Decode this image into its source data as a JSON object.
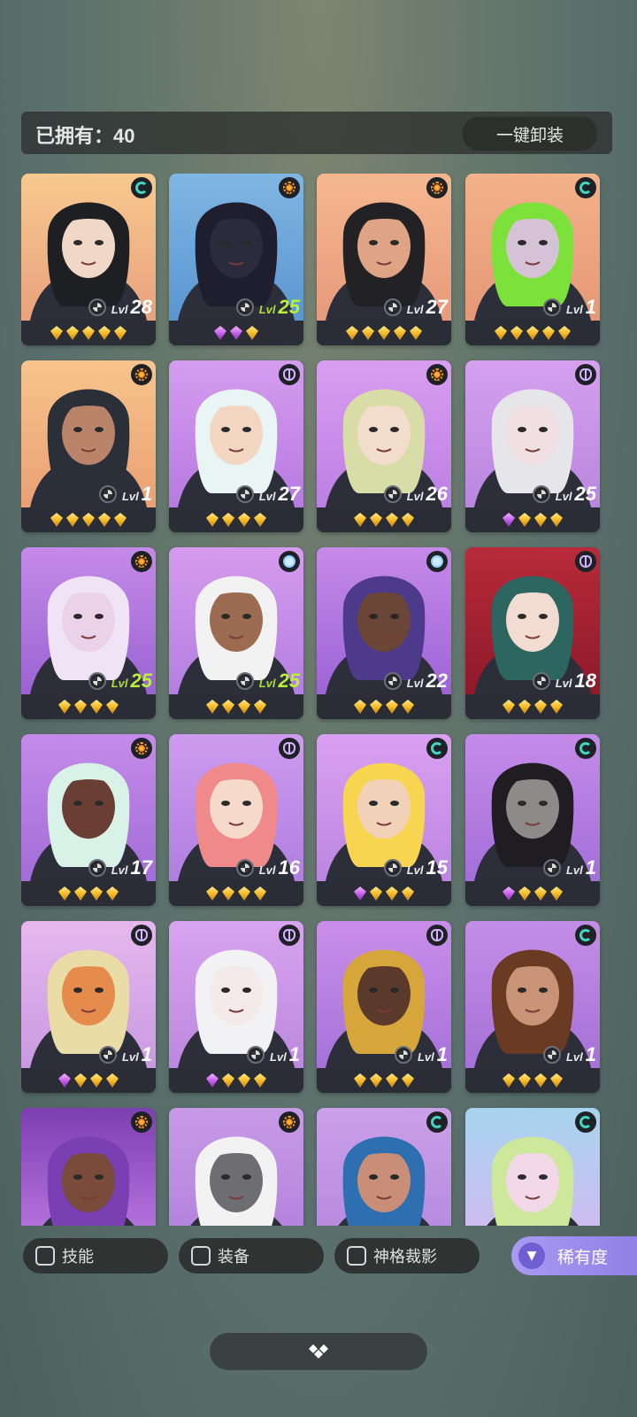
{
  "header": {
    "owned_label": "已拥有：",
    "owned_count": "40",
    "unequip_label": "一键卸装"
  },
  "lvl_prefix": "Lvl",
  "cards": [
    {
      "level": "28",
      "faction": "wind",
      "stars": [
        "gold",
        "gold",
        "gold",
        "gold",
        "gold"
      ],
      "bg": [
        "#f7c98f",
        "#e9a17d"
      ],
      "hair": "#1d1f22",
      "skin": "#f0d7c6",
      "hi": false
    },
    {
      "level": "25",
      "faction": "sun",
      "stars": [
        "purple",
        "purple",
        "gold"
      ],
      "bg": [
        "#7fb6e4",
        "#5a95cf"
      ],
      "hair": "#1e1e2e",
      "skin": "#2b2b3b",
      "hi": true
    },
    {
      "level": "27",
      "faction": "sun",
      "stars": [
        "gold",
        "gold",
        "gold",
        "gold",
        "gold"
      ],
      "bg": [
        "#f5b78f",
        "#e79a7d"
      ],
      "hair": "#222124",
      "skin": "#dfa486",
      "hi": false
    },
    {
      "level": "1",
      "faction": "wind",
      "stars": [
        "gold",
        "gold",
        "gold",
        "gold",
        "gold"
      ],
      "bg": [
        "#f2b28a",
        "#e69776"
      ],
      "hair": "#7de13b",
      "skin": "#d6c2d6",
      "hi": false
    },
    {
      "level": "1",
      "faction": "sun",
      "stars": [
        "gold",
        "gold",
        "gold",
        "gold",
        "gold"
      ],
      "bg": [
        "#f8c48d",
        "#e9a074"
      ],
      "hair": "#2b2f38",
      "skin": "#b9846a",
      "hi": false
    },
    {
      "level": "27",
      "faction": "moon",
      "stars": [
        "gold",
        "gold",
        "gold",
        "gold"
      ],
      "bg": [
        "#d49cf0",
        "#b77ae0"
      ],
      "hair": "#e9f5f5",
      "skin": "#f3d6c2",
      "hi": false
    },
    {
      "level": "26",
      "faction": "sun",
      "stars": [
        "gold",
        "gold",
        "gold",
        "gold"
      ],
      "bg": [
        "#d99df1",
        "#bb80e2"
      ],
      "hair": "#d8dca6",
      "skin": "#f2dccb",
      "hi": false
    },
    {
      "level": "25",
      "faction": "moon",
      "stars": [
        "purple",
        "gold",
        "gold",
        "gold"
      ],
      "bg": [
        "#d6a0ef",
        "#b986df"
      ],
      "hair": "#e6e6ea",
      "skin": "#f0e0e4",
      "hi": false
    },
    {
      "level": "25",
      "faction": "sun",
      "stars": [
        "gold",
        "gold",
        "gold",
        "gold"
      ],
      "bg": [
        "#c58ae8",
        "#9a63d2"
      ],
      "hair": "#efe3f5",
      "skin": "#ead2e8",
      "hi": true
    },
    {
      "level": "25",
      "faction": "cross",
      "stars": [
        "gold",
        "gold",
        "gold",
        "gold"
      ],
      "bg": [
        "#d59bee",
        "#b37fe0"
      ],
      "hair": "#f2f2f2",
      "skin": "#9c6b52",
      "hi": true
    },
    {
      "level": "22",
      "faction": "cross",
      "stars": [
        "gold",
        "gold",
        "gold",
        "gold"
      ],
      "bg": [
        "#c68ae9",
        "#9d64d6"
      ],
      "hair": "#4d3a8a",
      "skin": "#6b4536",
      "hi": false
    },
    {
      "level": "18",
      "faction": "moon",
      "stars": [
        "gold",
        "gold",
        "gold",
        "gold"
      ],
      "bg": [
        "#b82a3a",
        "#8e1a2a"
      ],
      "hair": "#2d6660",
      "skin": "#f2dcd2",
      "hi": false
    },
    {
      "level": "17",
      "faction": "sun",
      "stars": [
        "gold",
        "gold",
        "gold",
        "gold"
      ],
      "bg": [
        "#c58be9",
        "#a26dd8"
      ],
      "hair": "#d8f2e8",
      "skin": "#6a3e33",
      "hi": false
    },
    {
      "level": "16",
      "faction": "moon",
      "stars": [
        "gold",
        "gold",
        "gold",
        "gold"
      ],
      "bg": [
        "#ce9bef",
        "#b07fdf"
      ],
      "hair": "#f08a8a",
      "skin": "#f5dacc",
      "hi": false
    },
    {
      "level": "15",
      "faction": "wind",
      "stars": [
        "purple",
        "gold",
        "gold",
        "gold"
      ],
      "bg": [
        "#d9a0f1",
        "#bc85e1"
      ],
      "hair": "#f7d550",
      "skin": "#f1d2b8",
      "hi": false
    },
    {
      "level": "1",
      "faction": "wind",
      "stars": [
        "purple",
        "gold",
        "gold",
        "gold"
      ],
      "bg": [
        "#c58be9",
        "#a36fd9"
      ],
      "hair": "#1f1d22",
      "skin": "#8d8a8a",
      "hi": false
    },
    {
      "level": "1",
      "faction": "moon",
      "stars": [
        "purple",
        "gold",
        "gold",
        "gold"
      ],
      "bg": [
        "#e6b7ee",
        "#c99ae0"
      ],
      "hair": "#e9dca6",
      "skin": "#e58b4c",
      "hi": false
    },
    {
      "level": "1",
      "faction": "moon",
      "stars": [
        "purple",
        "gold",
        "gold",
        "gold"
      ],
      "bg": [
        "#d8a4ef",
        "#bc88df"
      ],
      "hair": "#f2f2f5",
      "skin": "#f5eaea",
      "hi": false
    },
    {
      "level": "1",
      "faction": "moon",
      "stars": [
        "gold",
        "gold",
        "gold",
        "gold"
      ],
      "bg": [
        "#c98ee9",
        "#a672da"
      ],
      "hair": "#d7a63a",
      "skin": "#5b3a2c",
      "hi": false
    },
    {
      "level": "1",
      "faction": "wind",
      "stars": [
        "gold",
        "gold",
        "gold",
        "gold"
      ],
      "bg": [
        "#c48de6",
        "#a671d8"
      ],
      "hair": "#6b3a22",
      "skin": "#c99377",
      "hi": false
    },
    {
      "level": "",
      "faction": "sun",
      "stars": [],
      "bg": [
        "#7c3fb0",
        "#c07de6"
      ],
      "hair": "#7a3fb2",
      "skin": "#7a4a3a",
      "hi": false
    },
    {
      "level": "",
      "faction": "sun",
      "stars": [],
      "bg": [
        "#c79ae6",
        "#b07fdc"
      ],
      "hair": "#f2f2f2",
      "skin": "#6d6d72",
      "hi": false
    },
    {
      "level": "",
      "faction": "wind",
      "stars": [],
      "bg": [
        "#caa0e8",
        "#b287de"
      ],
      "hair": "#2d6fb0",
      "skin": "#c98e78",
      "hi": false
    },
    {
      "level": "",
      "faction": "wind",
      "stars": [],
      "bg": [
        "#a6d4ef",
        "#d8b8f0"
      ],
      "hair": "#cde89a",
      "skin": "#f2d8e6",
      "hi": false
    }
  ],
  "filters": [
    {
      "label": "技能"
    },
    {
      "label": "装备"
    },
    {
      "label": "神格裁影"
    }
  ],
  "rarity_label": "稀有度",
  "bottom_icon": "collapse-diamond-icon"
}
